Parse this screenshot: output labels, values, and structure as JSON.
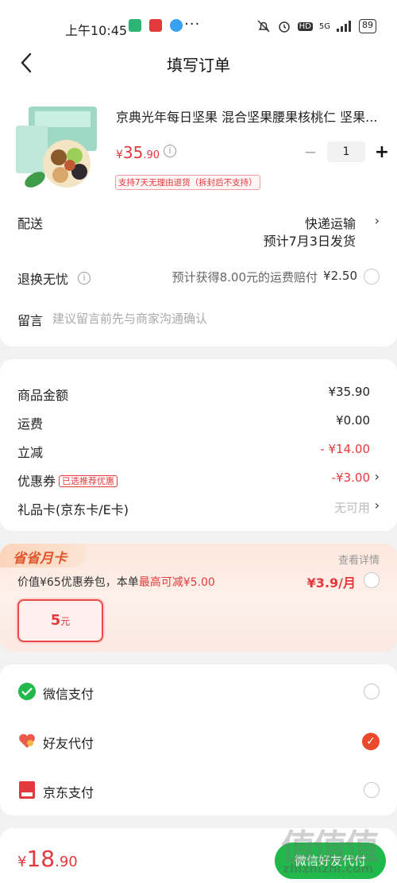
{
  "status_bar": {
    "time": "上午10:45",
    "dots": "···",
    "network": "5G",
    "hd": "HD",
    "battery": "89"
  },
  "header": {
    "title": "填写订单"
  },
  "product": {
    "name": "京典光年每日坚果 混合坚果腰果核桃仁 坚果...",
    "price_currency": "¥",
    "price_int": "35",
    "price_dec": ".90",
    "quantity": "1",
    "return_tag": "支持7天无理由退货（拆封后不支持）"
  },
  "delivery": {
    "label": "配送",
    "method": "快递运输",
    "date": "预计7月3日发货"
  },
  "return_insurance": {
    "label": "退换无忧",
    "note": "预计获得8.00元的运费赔付",
    "fee": "¥2.50"
  },
  "message": {
    "label": "留言",
    "placeholder": "建议留言前先与商家沟通确认"
  },
  "summary": {
    "goods_label": "商品金额",
    "goods_value": "¥35.90",
    "shipping_label": "运费",
    "shipping_value": "¥0.00",
    "discount_label": "立减",
    "discount_value": "- ¥14.00",
    "coupon_label": "优惠券",
    "coupon_tag": "已选推荐优惠",
    "coupon_value": "-¥3.00",
    "giftcard_label": "礼品卡(京东卡/E卡)",
    "giftcard_value": "无可用"
  },
  "month_card": {
    "badge": "省省月卡",
    "view_detail": "查看详情",
    "desc_prefix": "价值¥65优惠券包，本单",
    "desc_highlight": "最高可减¥5.00",
    "price": "¥3.9/月",
    "coupon_value": "5",
    "coupon_unit": "元"
  },
  "payment": {
    "options": [
      {
        "label": "微信支付",
        "icon": "wechat-pay-icon",
        "selected": false
      },
      {
        "label": "好友代付",
        "icon": "friend-pay-icon",
        "selected": true
      },
      {
        "label": "京东支付",
        "icon": "jd-pay-icon",
        "selected": false
      }
    ]
  },
  "footer": {
    "total_currency": "¥",
    "total_int": "18",
    "total_dec": ".90",
    "pay_button": "微信好友代付",
    "watermark": "值值值",
    "watermark_url": "zhizhizhi.com"
  },
  "colors": {
    "accent": "#e4393c",
    "wechat_green": "#21b84c"
  }
}
